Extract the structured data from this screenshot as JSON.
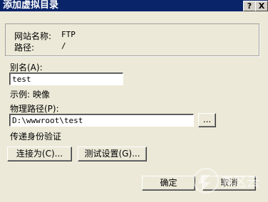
{
  "window": {
    "title": "添加虚拟目录",
    "help_button": "?",
    "close_button": "X"
  },
  "info": {
    "site_name_label": "网站名称:",
    "site_name_value": "FTP",
    "path_label": "路径:",
    "path_value": "/"
  },
  "alias": {
    "label": "别名(A):",
    "value": "test",
    "example": "示例: 映像"
  },
  "physical_path": {
    "label": "物理路径(P):",
    "value": "D:\\wwwroot\\test",
    "browse_label": "..."
  },
  "auth": {
    "label": "传递身份验证",
    "connect_as_button": "连接为(C)...",
    "test_settings_button": "测试设置(G)..."
  },
  "footer": {
    "ok_button": "确定",
    "cancel_button": "取消"
  },
  "watermark": {
    "text": "黑区云"
  }
}
